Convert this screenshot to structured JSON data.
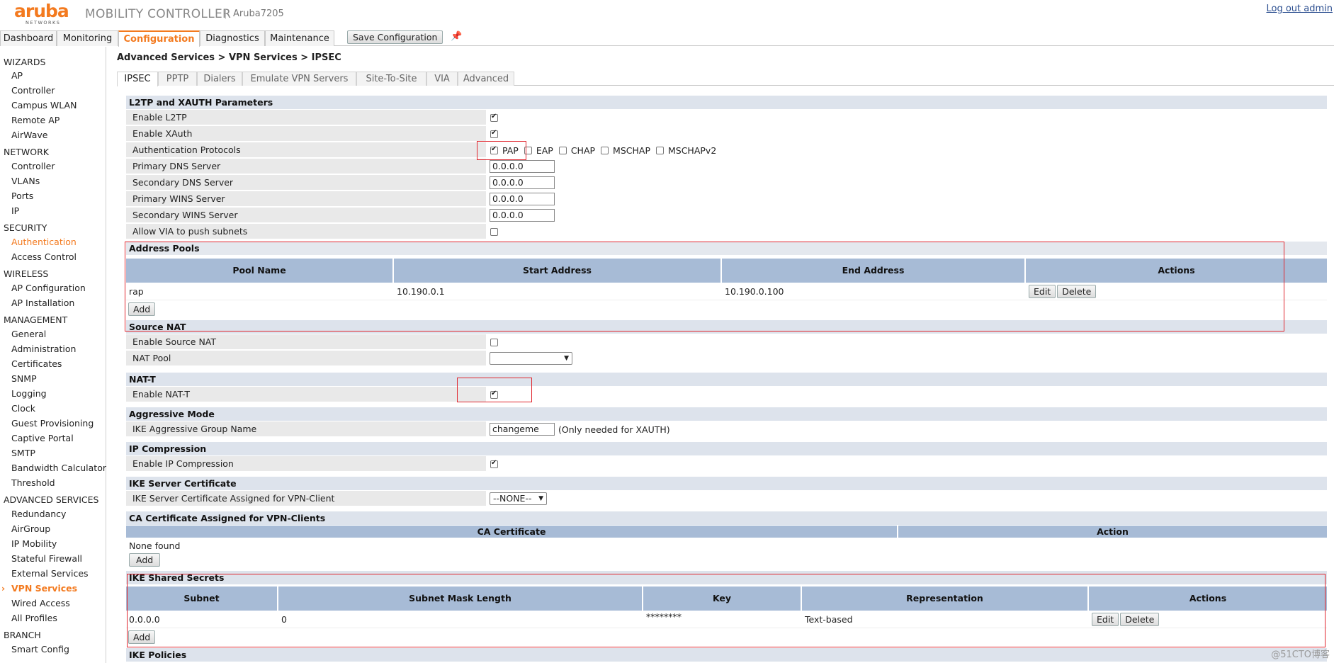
{
  "header": {
    "logo_word": "aruba",
    "logo_sub": "NETWORKS",
    "product": "MOBILITY CONTROLLER",
    "separator": "|",
    "host": "Aruba7205",
    "logout": "Log out admin"
  },
  "topnav": {
    "tabs": [
      "Dashboard",
      "Monitoring",
      "Configuration",
      "Diagnostics",
      "Maintenance"
    ],
    "active": "Configuration",
    "save_label": "Save Configuration"
  },
  "sidebar": {
    "wizards": "WIZARDS",
    "wizards_items": [
      "AP",
      "Controller",
      "Campus WLAN",
      "Remote AP",
      "AirWave"
    ],
    "network": "NETWORK",
    "network_items": [
      "Controller",
      "VLANs",
      "Ports",
      "IP"
    ],
    "security": "SECURITY",
    "security_items": [
      "Authentication",
      "Access Control"
    ],
    "wireless": "WIRELESS",
    "wireless_items": [
      "AP Configuration",
      "AP Installation"
    ],
    "management": "MANAGEMENT",
    "management_items": [
      "General",
      "Administration",
      "Certificates",
      "SNMP",
      "Logging",
      "Clock",
      "Guest Provisioning",
      "Captive Portal",
      "SMTP",
      "Bandwidth Calculator",
      "Threshold"
    ],
    "advanced": "ADVANCED SERVICES",
    "advanced_items": [
      "Redundancy",
      "AirGroup",
      "IP Mobility",
      "Stateful Firewall",
      "External Services",
      "VPN Services",
      "Wired Access",
      "All Profiles"
    ],
    "branch": "BRANCH",
    "branch_items": [
      "Smart Config"
    ]
  },
  "breadcrumb": "Advanced Services > VPN Services > IPSEC",
  "subtabs": [
    "IPSEC",
    "PPTP",
    "Dialers",
    "Emulate VPN Servers",
    "Site-To-Site",
    "VIA",
    "Advanced"
  ],
  "l2tp": {
    "title": "L2TP and XAUTH Parameters",
    "enable_l2tp": "Enable L2TP",
    "enable_xauth": "Enable XAuth",
    "auth_protocols": "Authentication Protocols",
    "protocols": [
      "PAP",
      "EAP",
      "CHAP",
      "MSCHAP",
      "MSCHAPv2"
    ],
    "primary_dns": "Primary DNS Server",
    "primary_dns_val": "0.0.0.0",
    "secondary_dns": "Secondary DNS Server",
    "secondary_dns_val": "0.0.0.0",
    "primary_wins": "Primary WINS Server",
    "primary_wins_val": "0.0.0.0",
    "secondary_wins": "Secondary WINS Server",
    "secondary_wins_val": "0.0.0.0",
    "allow_via": "Allow VIA to push subnets"
  },
  "address_pools": {
    "title": "Address Pools",
    "columns": [
      "Pool Name",
      "Start Address",
      "End Address",
      "Actions"
    ],
    "rows": [
      {
        "name": "rap",
        "start": "10.190.0.1",
        "end": "10.190.0.100"
      }
    ],
    "edit": "Edit",
    "delete": "Delete",
    "add": "Add"
  },
  "source_nat": {
    "title": "Source NAT",
    "enable": "Enable Source NAT",
    "nat_pool": "NAT Pool",
    "nat_pool_val": ""
  },
  "nat_t": {
    "title": "NAT-T",
    "enable": "Enable NAT-T"
  },
  "aggressive": {
    "title": "Aggressive Mode",
    "group_name": "IKE Aggressive Group Name",
    "group_val": "changeme",
    "note": "(Only needed for XAUTH)"
  },
  "ip_compression": {
    "title": "IP Compression",
    "enable": "Enable IP Compression"
  },
  "ike_cert": {
    "title": "IKE Server Certificate",
    "label": "IKE Server Certificate Assigned for VPN-Client",
    "val": "--NONE--"
  },
  "ca_cert": {
    "title": "CA Certificate Assigned for VPN-Clients",
    "columns": [
      "CA Certificate",
      "Action"
    ],
    "none_found": "None found",
    "add": "Add"
  },
  "ike_secrets": {
    "title": "IKE Shared Secrets",
    "columns": [
      "Subnet",
      "Subnet Mask Length",
      "Key",
      "Representation",
      "Actions"
    ],
    "rows": [
      {
        "subnet": "0.0.0.0",
        "mask": "0",
        "key": "********",
        "rep": "Text-based"
      }
    ],
    "edit": "Edit",
    "delete": "Delete",
    "add": "Add"
  },
  "ike_policies": {
    "title": "IKE Policies"
  },
  "watermark": "@51CTO博客",
  "colors": {
    "accent": "#f37a1f",
    "section_bg": "#dde3ec",
    "table_header": "#a7bbd6",
    "highlight": "#e0262e"
  }
}
